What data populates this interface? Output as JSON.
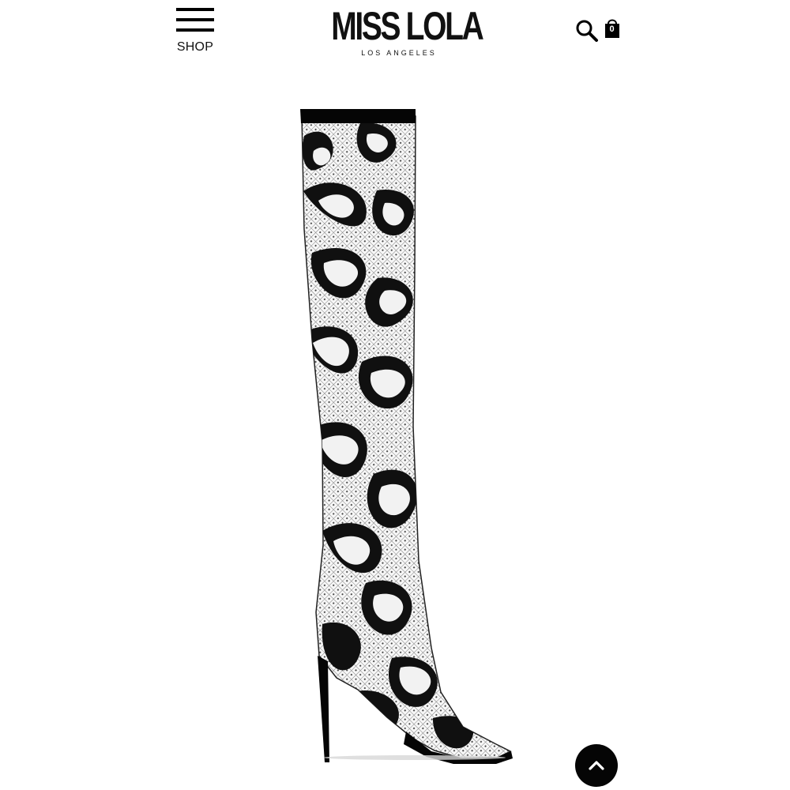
{
  "header": {
    "menu_label": "SHOP",
    "logo_text": "MISS LOLA",
    "logo_subtext": "LOS ANGELES",
    "search_icon": "search-icon",
    "bag_icon": "shopping-bag-icon",
    "bag_count": "0"
  },
  "product": {
    "image_subject": "snakeskin over-the-knee peep-toe stiletto boot",
    "colors": {
      "primary": "#111111",
      "secondary": "#f7f7f7"
    }
  },
  "floating": {
    "scroll_top_icon": "chevron-up-icon",
    "button_color": "#050505"
  }
}
